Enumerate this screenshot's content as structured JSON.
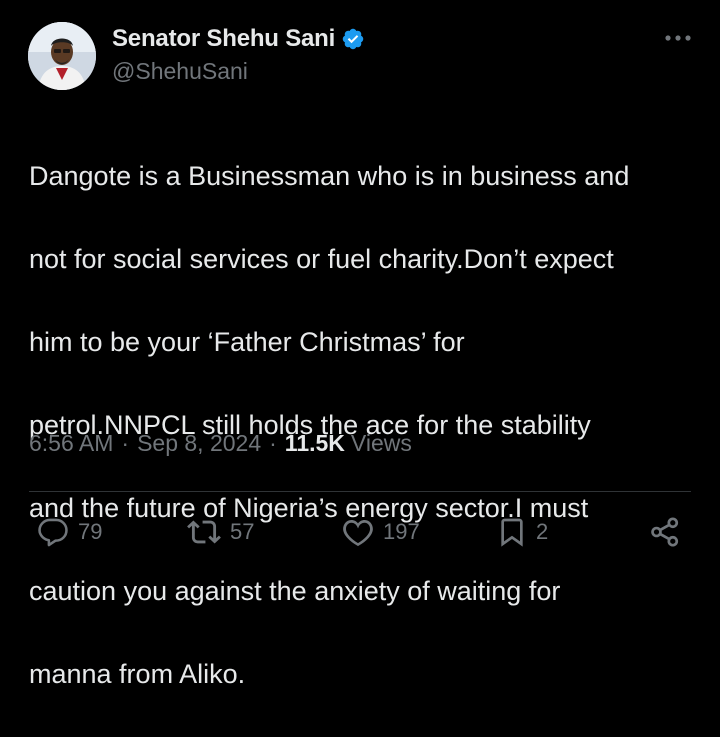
{
  "author": {
    "display_name": "Senator Shehu Sani",
    "handle": "@ShehuSani",
    "verified_icon": "verified-badge-icon",
    "avatar_icon": "profile-avatar"
  },
  "tweet": {
    "text_lines": [
      "Dangote is a Businessman who is in business and",
      "not for social services or fuel charity.Don’t expect",
      "him to be your ‘Father Christmas’ for",
      "petrol.NNPCL still holds the ace for the stability",
      "and the future of Nigeria’s energy sector.I must",
      "caution you against the anxiety of waiting for",
      "manna from Aliko."
    ]
  },
  "meta": {
    "time": "6:56 AM",
    "separator": "·",
    "date": "Sep 8, 2024",
    "views_count": "11.5K",
    "views_label": "Views"
  },
  "actions": {
    "replies": "79",
    "reposts": "57",
    "likes": "197",
    "bookmarks": "2"
  },
  "colors": {
    "background": "#000000",
    "text": "#e7e9ea",
    "secondary": "#71767b",
    "verified": "#1d9bf0",
    "divider": "#2f3336"
  }
}
